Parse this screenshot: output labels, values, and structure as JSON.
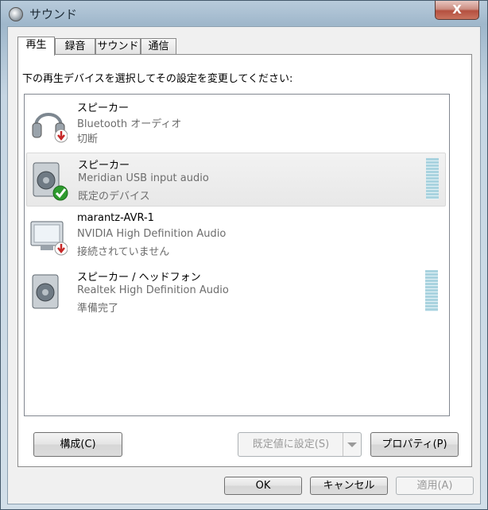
{
  "window": {
    "title": "サウンド",
    "close_glyph": "X"
  },
  "tabs": [
    {
      "label": "再生"
    },
    {
      "label": "録音"
    },
    {
      "label": "サウンド"
    },
    {
      "label": "通信"
    }
  ],
  "instruction": "下の再生デバイスを選択してその設定を変更してください:",
  "devices": [
    {
      "name": "スピーカー",
      "driver": "Bluetooth オーディオ",
      "status": "切断",
      "icon": "headphones-icon",
      "badge": "disconnected-badge"
    },
    {
      "name": "スピーカー",
      "driver": "Meridian USB input audio",
      "status": "既定のデバイス",
      "icon": "speaker-icon",
      "badge": "default-check-badge",
      "selected": true,
      "level_meter": true
    },
    {
      "name": "marantz-AVR-1",
      "driver": "NVIDIA High Definition Audio",
      "status": "接続されていません",
      "icon": "monitor-icon",
      "badge": "disconnected-badge"
    },
    {
      "name": "スピーカー / ヘッドフォン",
      "driver": "Realtek High Definition Audio",
      "status": "準備完了",
      "icon": "speaker-icon",
      "level_meter": true
    }
  ],
  "buttons": {
    "configure": "構成(C)",
    "set_default": "既定値に設定(S)",
    "properties": "プロパティ(P)",
    "ok": "OK",
    "cancel": "キャンセル",
    "apply": "適用(A)"
  },
  "colors": {
    "accent_check": "#2e9b2e",
    "disconnect_red": "#c62828",
    "meter": "#a9d3df"
  }
}
